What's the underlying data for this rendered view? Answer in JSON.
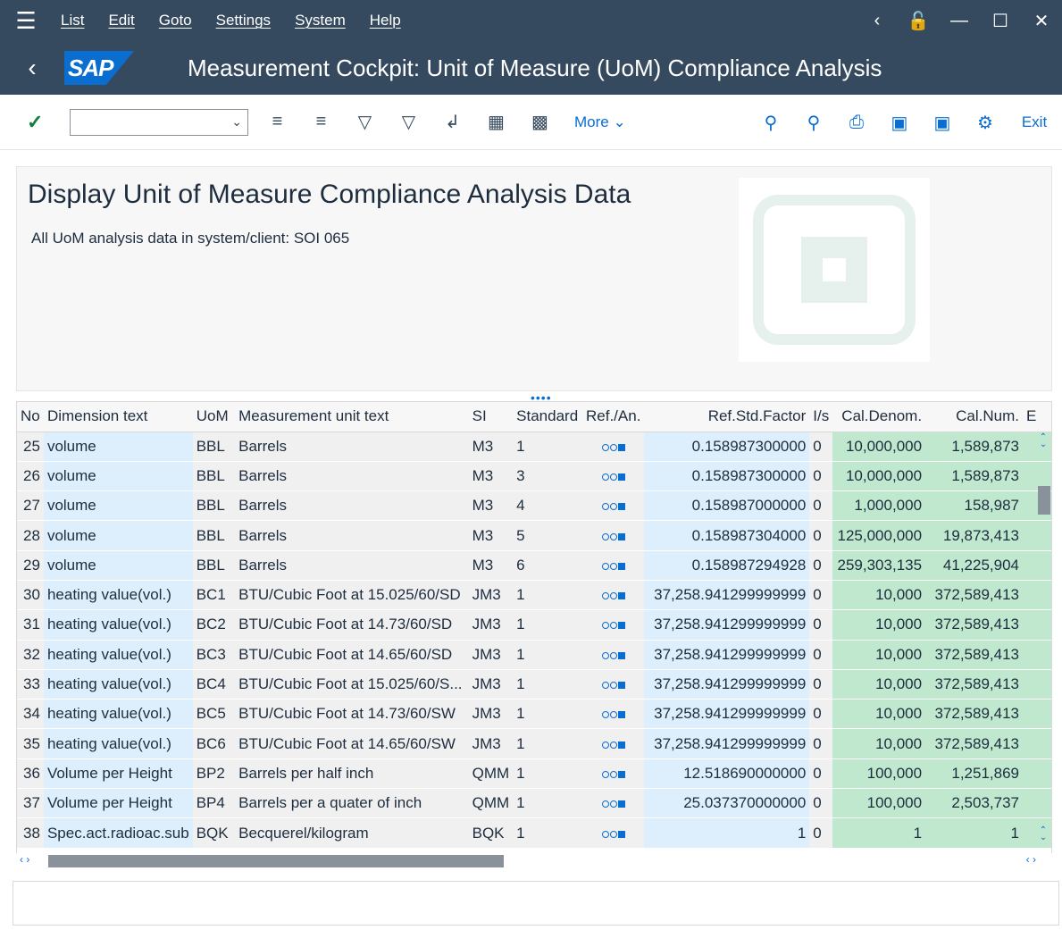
{
  "menubar": {
    "items": [
      "List",
      "Edit",
      "Goto",
      "Settings",
      "System",
      "Help"
    ]
  },
  "title": "Measurement Cockpit: Unit of Measure (UoM) Compliance Analysis",
  "logo_text": "SAP",
  "toolbar": {
    "more_label": "More",
    "exit_label": "Exit"
  },
  "header": {
    "heading": "Display Unit of Measure Compliance Analysis Data",
    "subtitle": "All UoM analysis data in system/client: SOI 065"
  },
  "grid": {
    "columns": [
      "No",
      "Dimension text",
      "UoM",
      "Measurement unit text",
      "SI",
      "Standard",
      "Ref./An.",
      "Ref.Std.Factor",
      "I/s",
      "Cal.Denom.",
      "Cal.Num.",
      "E"
    ],
    "rows": [
      {
        "no": "25",
        "dim": "volume",
        "uom": "BBL",
        "text": "Barrels",
        "si": "M3",
        "std": "1",
        "factor": "0.158987300000",
        "is": "0",
        "den": "10,000,000",
        "num": "1,589,873"
      },
      {
        "no": "26",
        "dim": "volume",
        "uom": "BBL",
        "text": "Barrels",
        "si": "M3",
        "std": "3",
        "factor": "0.158987300000",
        "is": "0",
        "den": "10,000,000",
        "num": "1,589,873"
      },
      {
        "no": "27",
        "dim": "volume",
        "uom": "BBL",
        "text": "Barrels",
        "si": "M3",
        "std": "4",
        "factor": "0.158987000000",
        "is": "0",
        "den": "1,000,000",
        "num": "158,987"
      },
      {
        "no": "28",
        "dim": "volume",
        "uom": "BBL",
        "text": "Barrels",
        "si": "M3",
        "std": "5",
        "factor": "0.158987304000",
        "is": "0",
        "den": "125,000,000",
        "num": "19,873,413"
      },
      {
        "no": "29",
        "dim": "volume",
        "uom": "BBL",
        "text": "Barrels",
        "si": "M3",
        "std": "6",
        "factor": "0.158987294928",
        "is": "0",
        "den": "259,303,135",
        "num": "41,225,904"
      },
      {
        "no": "30",
        "dim": "heating value(vol.)",
        "uom": "BC1",
        "text": "BTU/Cubic Foot at 15.025/60/SD",
        "si": "JM3",
        "std": "1",
        "factor": "37,258.941299999999",
        "is": "0",
        "den": "10,000",
        "num": "372,589,413"
      },
      {
        "no": "31",
        "dim": "heating value(vol.)",
        "uom": "BC2",
        "text": "BTU/Cubic Foot at 14.73/60/SD",
        "si": "JM3",
        "std": "1",
        "factor": "37,258.941299999999",
        "is": "0",
        "den": "10,000",
        "num": "372,589,413"
      },
      {
        "no": "32",
        "dim": "heating value(vol.)",
        "uom": "BC3",
        "text": "BTU/Cubic Foot at 14.65/60/SD",
        "si": "JM3",
        "std": "1",
        "factor": "37,258.941299999999",
        "is": "0",
        "den": "10,000",
        "num": "372,589,413"
      },
      {
        "no": "33",
        "dim": "heating value(vol.)",
        "uom": "BC4",
        "text": "BTU/Cubic Foot at 15.025/60/S...",
        "si": "JM3",
        "std": "1",
        "factor": "37,258.941299999999",
        "is": "0",
        "den": "10,000",
        "num": "372,589,413"
      },
      {
        "no": "34",
        "dim": "heating value(vol.)",
        "uom": "BC5",
        "text": "BTU/Cubic Foot at 14.73/60/SW",
        "si": "JM3",
        "std": "1",
        "factor": "37,258.941299999999",
        "is": "0",
        "den": "10,000",
        "num": "372,589,413"
      },
      {
        "no": "35",
        "dim": "heating value(vol.)",
        "uom": "BC6",
        "text": "BTU/Cubic Foot at 14.65/60/SW",
        "si": "JM3",
        "std": "1",
        "factor": "37,258.941299999999",
        "is": "0",
        "den": "10,000",
        "num": "372,589,413"
      },
      {
        "no": "36",
        "dim": "Volume per Height",
        "uom": "BP2",
        "text": "Barrels per half inch",
        "si": "QMM",
        "std": "1",
        "factor": "12.518690000000",
        "is": "0",
        "den": "100,000",
        "num": "1,251,869"
      },
      {
        "no": "37",
        "dim": "Volume per Height",
        "uom": "BP4",
        "text": "Barrels per a quater of inch",
        "si": "QMM",
        "std": "1",
        "factor": "25.037370000000",
        "is": "0",
        "den": "100,000",
        "num": "2,503,737"
      },
      {
        "no": "38",
        "dim": "Spec.act.radioac.sub",
        "uom": "BQK",
        "text": "Becquerel/kilogram",
        "si": "BQK",
        "std": "1",
        "factor": "1",
        "is": "0",
        "den": "1",
        "num": "1"
      }
    ]
  },
  "colors": {
    "shell": "#354a5f",
    "accent": "#0a6ed1",
    "key_column": "#ddeefc",
    "calc_column": "#bfe8cf"
  }
}
